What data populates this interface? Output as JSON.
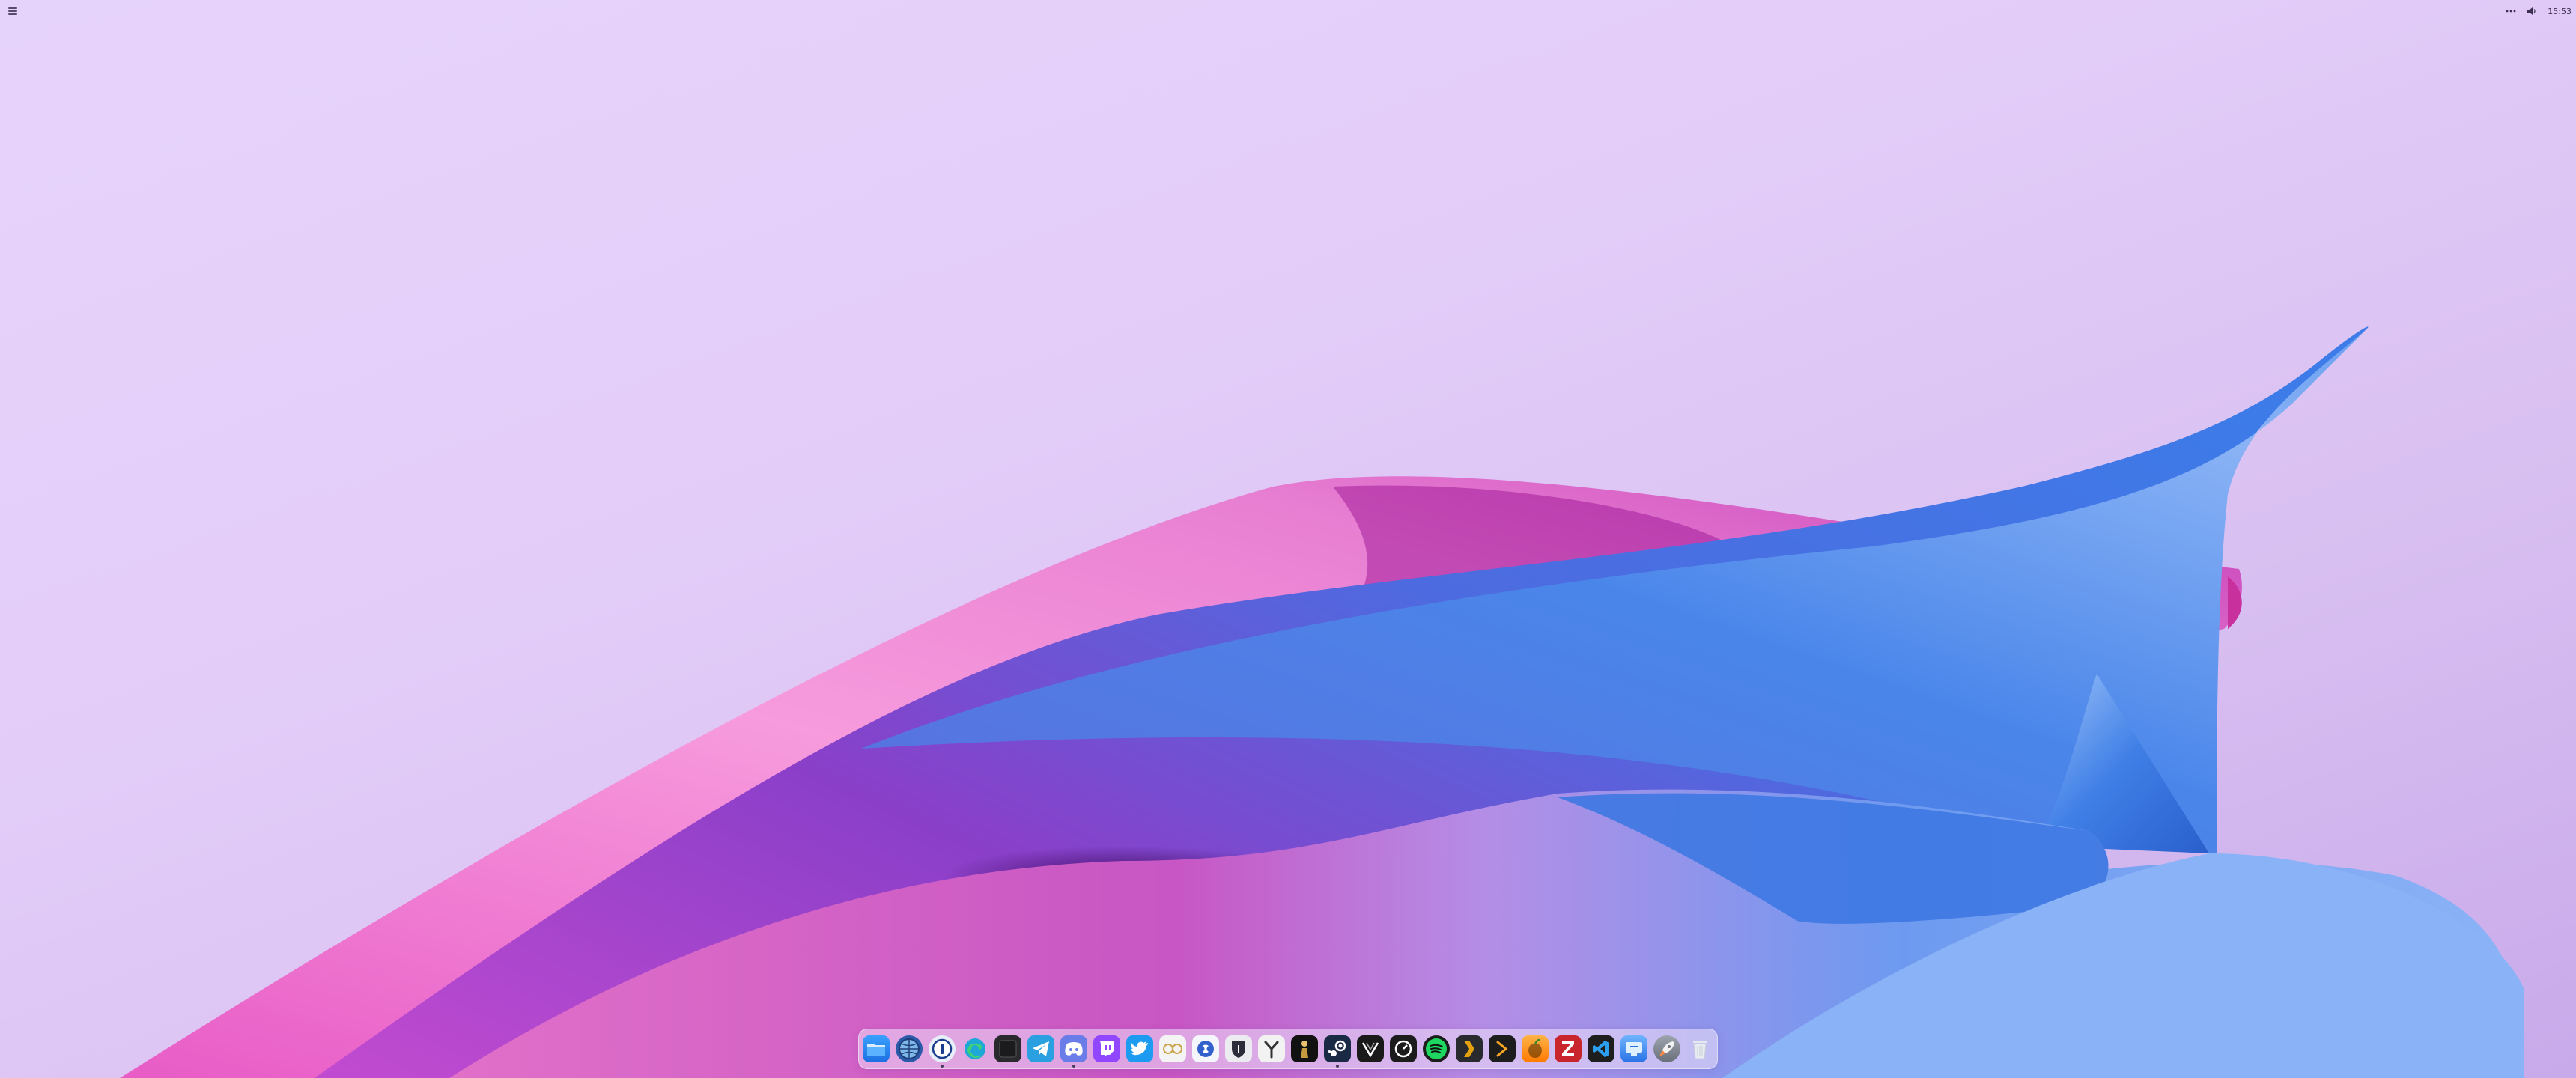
{
  "top_bar": {
    "menu_icon": "hamburger-menu-icon",
    "status": {
      "overflow_icon": "more-dots-icon",
      "volume_icon": "speaker-icon",
      "clock": "15:53"
    }
  },
  "wallpaper": {
    "colors": {
      "background_light": "#e6d3fb",
      "background_dark": "#c8a9ea",
      "pink": "#ee7fd0",
      "magenta": "#b02aa8",
      "blue": "#3f7fe6",
      "light_blue": "#8fb6f6"
    }
  },
  "dock": {
    "items": [
      {
        "name": "finder",
        "icon": "folder-icon",
        "running": false
      },
      {
        "name": "web-browser",
        "icon": "globe-browser-icon",
        "running": false
      },
      {
        "name": "1password",
        "icon": "password-key-icon",
        "running": true
      },
      {
        "name": "edge",
        "icon": "edge-browser-icon",
        "running": false
      },
      {
        "name": "terminal",
        "icon": "terminal-icon",
        "running": false
      },
      {
        "name": "telegram",
        "icon": "telegram-icon",
        "running": false
      },
      {
        "name": "discord",
        "icon": "discord-icon",
        "running": true
      },
      {
        "name": "twitch",
        "icon": "twitch-icon",
        "running": false
      },
      {
        "name": "twitter",
        "icon": "twitter-bird-icon",
        "running": false
      },
      {
        "name": "glasses-app",
        "icon": "glasses-icon",
        "running": false
      },
      {
        "name": "simplenote",
        "icon": "simplenote-icon",
        "running": false
      },
      {
        "name": "bitwarden",
        "icon": "shield-number-icon",
        "running": false
      },
      {
        "name": "fork",
        "icon": "fork-icon",
        "running": false
      },
      {
        "name": "game-launcher",
        "icon": "character-icon",
        "running": false
      },
      {
        "name": "steam",
        "icon": "steam-icon",
        "running": true
      },
      {
        "name": "vectorize",
        "icon": "vector-v-icon",
        "running": false
      },
      {
        "name": "speedometer-app",
        "icon": "gauge-icon",
        "running": false
      },
      {
        "name": "spotify",
        "icon": "spotify-icon",
        "running": false
      },
      {
        "name": "plex",
        "icon": "plex-chevron-icon",
        "running": false
      },
      {
        "name": "prompt",
        "icon": "prompt-chevron-icon",
        "running": false
      },
      {
        "name": "fl-studio",
        "icon": "fruit-icon",
        "running": false
      },
      {
        "name": "filezilla",
        "icon": "filezilla-icon",
        "running": false
      },
      {
        "name": "vscode",
        "icon": "vscode-icon",
        "running": false
      },
      {
        "name": "screen-sharing",
        "icon": "screen-share-icon",
        "running": false
      },
      {
        "name": "launchpad",
        "icon": "rocket-icon",
        "running": false
      },
      {
        "name": "trash",
        "icon": "trash-icon",
        "running": false
      }
    ]
  }
}
